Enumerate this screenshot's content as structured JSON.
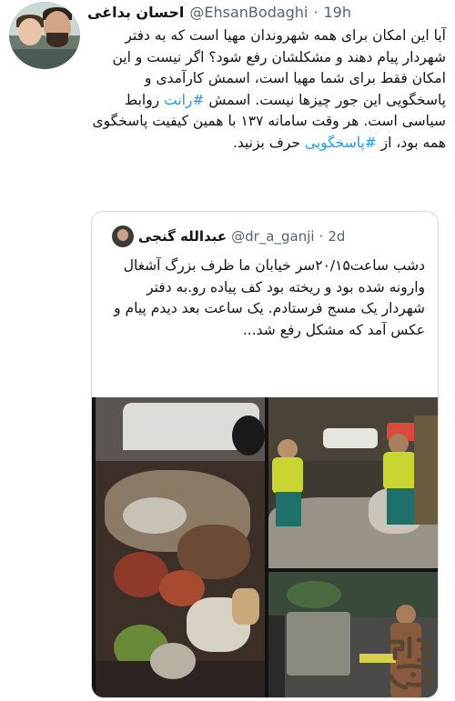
{
  "tweet": {
    "display_name": "احسان بداغی",
    "handle": "@EhsanBodaghi",
    "separator": "·",
    "time": "19h",
    "text_part1": "آیا این امکان برای همه شهروندان مهیا است که به دفتر شهردار پیام دهند و مشکلشان رفع شود؟ اگر نیست و این امکان فقط برای شما مهیا است، اسمش کارآمدی و پاسخگویی این جور چیزها نیست. اسمش ",
    "hashtag1": "#رانت",
    "text_part2": " روابط سیاسی است. هر وقت سامانه ۱۳۷ با همین کیفیت پاسخگوی همه بود، از ",
    "hashtag2": "#پاسخگویی",
    "text_part3": " حرف بزنید."
  },
  "quote": {
    "display_name": "عبدالله گنجی",
    "handle": "@dr_a_ganji",
    "separator": "·",
    "time": "2d",
    "text": "دشب ساعت۲۰/۱۵سر خیابان ما ظرف بزرگ آشغال وارونه شده بود و ریخته بود کف پیاده رو.به دفتر شهردار یک مسج فرستادم. یک ساعت بعد دیدم پیام و عکس آمد که مشکل رفع شد..."
  },
  "colors": {
    "link": "#1d9bf0",
    "secondary_text": "#536471",
    "border": "#cfd9de",
    "worker_uniform": "#c9d631",
    "worker_pants": "#1f6f6a",
    "watermark": "#5a4630"
  },
  "icons": [
    "avatar-ehsan",
    "avatar-ganji",
    "watermark-logo"
  ]
}
